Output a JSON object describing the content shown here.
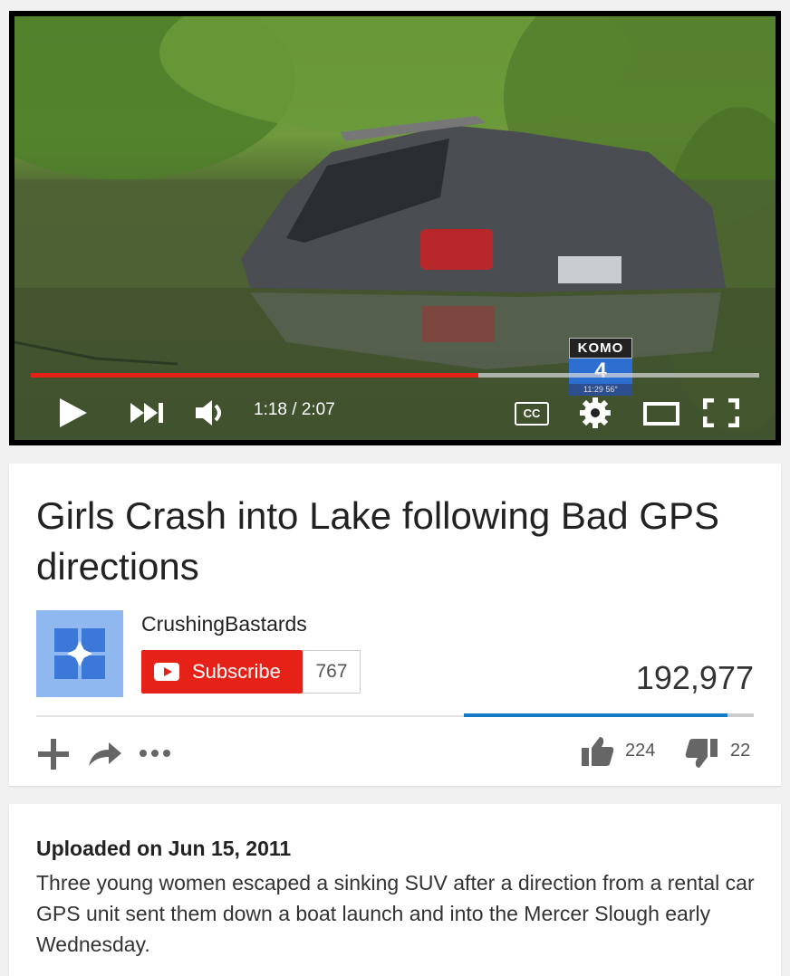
{
  "player": {
    "current_time": "1:18",
    "duration": "2:07",
    "time_display": "1:18 / 2:07",
    "progress_fraction": 0.614,
    "cc_label": "CC",
    "watermark": {
      "station": "KOMO",
      "channel_number": "4",
      "overlay_text": "11:29 56°"
    },
    "icons": [
      "play-icon",
      "next-icon",
      "volume-icon",
      "cc-icon",
      "settings-gear-icon",
      "theater-mode-icon",
      "fullscreen-icon"
    ]
  },
  "video": {
    "title": "Girls Crash into Lake following Bad GPS directions",
    "channel": "CrushingBastards",
    "subscribe_label": "Subscribe",
    "subscriber_count": "767",
    "views": "192,977",
    "likes": "224",
    "dislikes": "22",
    "like_ratio": 0.91
  },
  "description": {
    "uploaded": "Uploaded on Jun 15, 2011",
    "text": "Three young women escaped a sinking SUV after a direction from a rental car GPS unit sent them down a boat launch and into the Mercer Slough early Wednesday."
  },
  "colors": {
    "accent": "#e62117",
    "like_bar": "#167ac6",
    "avatar_bg": "#8fb7f0"
  }
}
